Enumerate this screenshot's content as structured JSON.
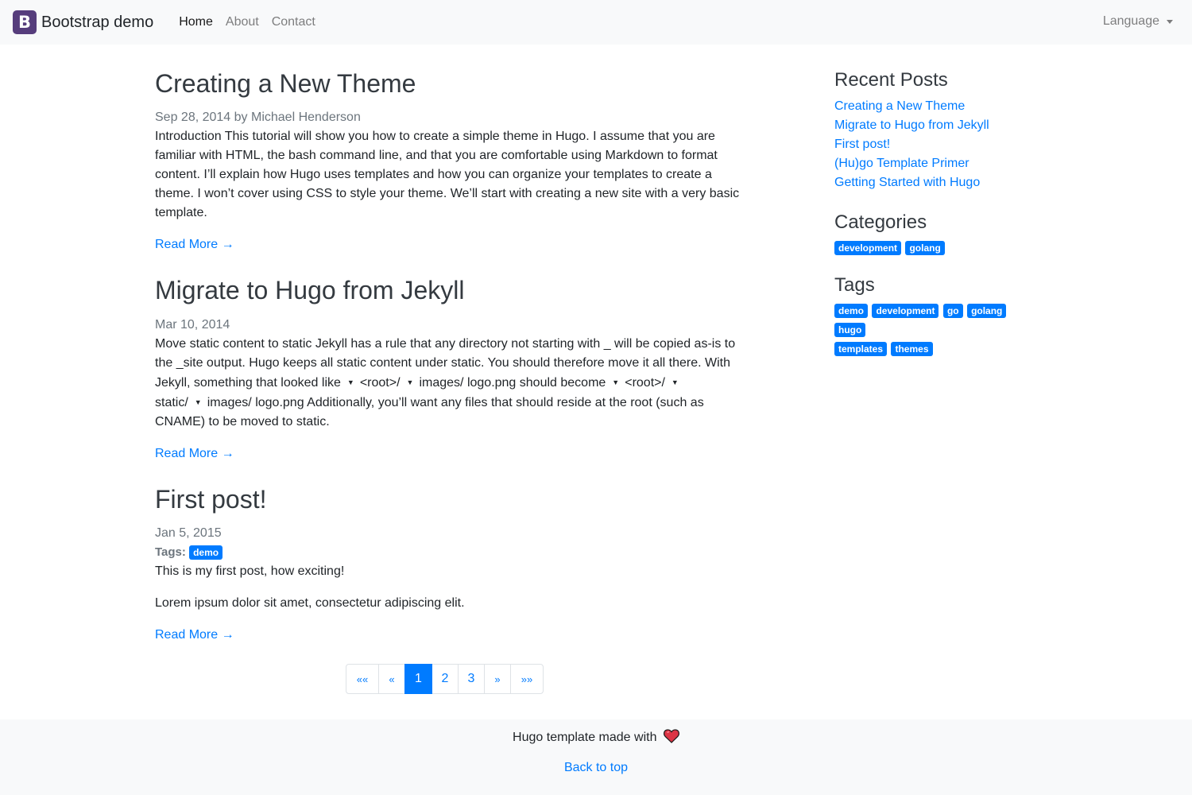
{
  "navbar": {
    "brand_letter": "B",
    "brand": "Bootstrap demo",
    "links": [
      "Home",
      "About",
      "Contact"
    ],
    "language": "Language"
  },
  "posts": [
    {
      "title": "Creating a New Theme",
      "date": "Sep 28, 2014",
      "author_text": " by Michael Henderson",
      "body": "Introduction This tutorial will show you how to create a simple theme in Hugo. I assume that you are familiar with HTML, the bash command line, and that you are comfortable using Markdown to format content. I’ll explain how Hugo uses templates and how you can organize your templates to create a theme. I won’t cover using CSS to style your theme. We’ll start with creating a new site with a very basic template.",
      "read_more": "Read More →"
    },
    {
      "title": "Migrate to Hugo from Jekyll",
      "date": "Mar 10, 2014",
      "body_a": "Move static content to static Jekyll has a rule that any directory not starting with _ will be copied as-is to the _site output. Hugo keeps all static content under static. You should therefore move it all there. With Jekyll, something that looked like",
      "tri": "▼",
      "root": "<root>/",
      "images": "images/",
      "logo": "logo.png should become",
      "static": "static/",
      "logo2": "logo.png Additionally, you’ll want any files that should reside at the root (such as CNAME) to be moved to static.",
      "read_more": "Read More →"
    },
    {
      "title": "First post!",
      "date": "Jan 5, 2015",
      "tags_label": "Tags:",
      "tag": "demo",
      "p1": "This is my first post, how exciting!",
      "p2": "Lorem ipsum dolor sit amet, consectetur adipiscing elit.",
      "read_more": "Read More →"
    }
  ],
  "pagination": {
    "first": "««",
    "prev": "«",
    "pages": [
      "1",
      "2",
      "3"
    ],
    "current": "1",
    "next": "»",
    "last": "»»"
  },
  "sidebar": {
    "recent_heading": "Recent Posts",
    "recent": [
      "Creating a New Theme",
      "Migrate to Hugo from Jekyll",
      "First post!",
      "(Hu)go Template Primer",
      "Getting Started with Hugo"
    ],
    "categories_heading": "Categories",
    "categories": [
      "development",
      "golang"
    ],
    "tags_heading": "Tags",
    "tags": [
      "demo",
      "development",
      "go",
      "golang",
      "hugo",
      "templates",
      "themes"
    ]
  },
  "footer": {
    "made_with": "Hugo template made with",
    "heart_icon": "heart-icon",
    "back_to_top": "Back to top"
  },
  "colors": {
    "link": "#007bff",
    "brand": "#563d7c",
    "navbar_bg": "#f8f9fa",
    "heart": "#dc3545"
  }
}
